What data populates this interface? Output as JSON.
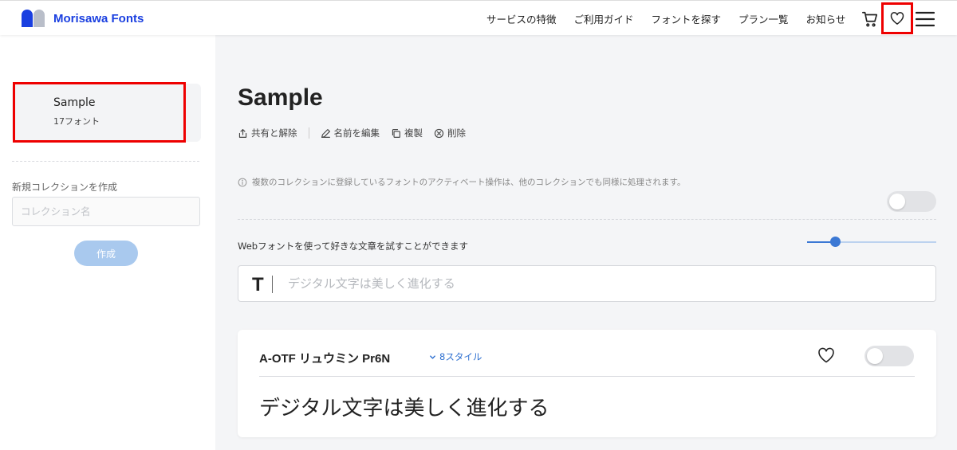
{
  "header": {
    "brand": "Morisawa Fonts",
    "nav": [
      "サービスの特徴",
      "ご利用ガイド",
      "フォントを探す",
      "プラン一覧",
      "お知らせ"
    ],
    "icons": {
      "cart": "cart-icon",
      "favorite": "heart-icon",
      "menu": "hamburger-menu-icon"
    }
  },
  "sidebar": {
    "collection": {
      "name": "Sample",
      "count": "17フォント"
    },
    "new_collection_label": "新規コレクションを作成",
    "collection_name_placeholder": "コレクション名",
    "create_button": "作成"
  },
  "main": {
    "title": "Sample",
    "actions": [
      {
        "label": "共有と解除",
        "icon": "share-icon"
      },
      {
        "label": "名前を編集",
        "icon": "pencil-icon"
      },
      {
        "label": "複製",
        "icon": "copy-icon"
      },
      {
        "label": "削除",
        "icon": "delete-icon"
      }
    ],
    "info_text": "複数のコレクションに登録しているフォントのアクティベート操作は、他のコレクションでも同様に処理されます。",
    "webfont_label": "Webフォントを使って好きな文章を試すことができます",
    "sample_placeholder": "デジタル文字は美しく進化する",
    "slider_value": 0.22,
    "font_card": {
      "name": "A-OTF リュウミン Pr6N",
      "styles": "8スタイル",
      "preview": "デジタル文字は美しく進化する"
    }
  },
  "colors": {
    "brand": "#1a3fe0",
    "highlight": "#ee0000",
    "link": "#2d6fd0",
    "slider": "#3b78d4",
    "button_disabled": "#a9c9ee"
  }
}
